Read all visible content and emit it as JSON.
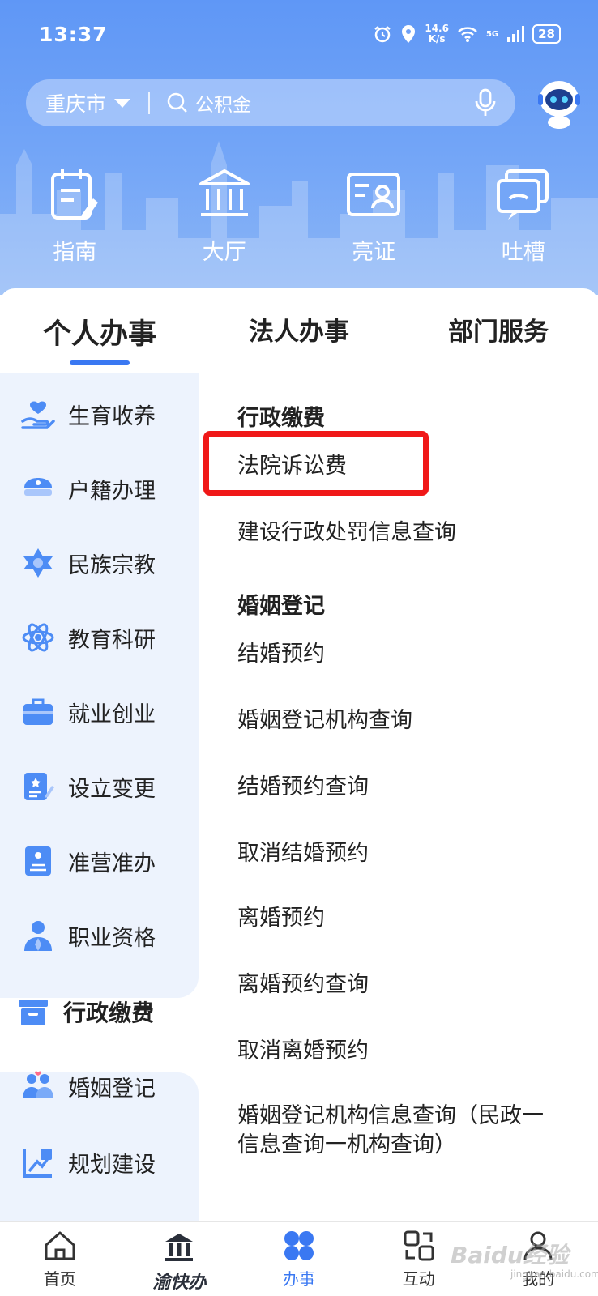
{
  "status_bar": {
    "time": "13:37",
    "net_speed_value": "14.6",
    "net_speed_unit": "K/s",
    "signal": "5G",
    "battery": "28"
  },
  "search": {
    "city": "重庆市",
    "placeholder": "公积金"
  },
  "quick_actions": [
    {
      "label": "指南",
      "icon": "guide-icon"
    },
    {
      "label": "大厅",
      "icon": "hall-icon"
    },
    {
      "label": "亮证",
      "icon": "id-card-icon"
    },
    {
      "label": "吐槽",
      "icon": "feedback-icon"
    }
  ],
  "tabs": [
    {
      "label": "个人办事",
      "active": true
    },
    {
      "label": "法人办事",
      "active": false
    },
    {
      "label": "部门服务",
      "active": false
    }
  ],
  "categories": [
    {
      "label": "生育收养",
      "icon": "hand-heart-icon"
    },
    {
      "label": "户籍办理",
      "icon": "police-cap-icon"
    },
    {
      "label": "民族宗教",
      "icon": "star-icon"
    },
    {
      "label": "教育科研",
      "icon": "atom-icon"
    },
    {
      "label": "就业创业",
      "icon": "briefcase-icon"
    },
    {
      "label": "设立变更",
      "icon": "document-edit-icon"
    },
    {
      "label": "准营准办",
      "icon": "license-icon"
    },
    {
      "label": "职业资格",
      "icon": "professional-icon"
    },
    {
      "label": "行政缴费",
      "icon": "box-icon",
      "active": true
    },
    {
      "label": "婚姻登记",
      "icon": "couple-icon"
    },
    {
      "label": "规划建设",
      "icon": "planning-icon"
    }
  ],
  "sections": [
    {
      "title": "行政缴费",
      "items": [
        "法院诉讼费",
        "建设行政处罚信息查询"
      ]
    },
    {
      "title": "婚姻登记",
      "items": [
        "结婚预约",
        "婚姻登记机构查询",
        "结婚预约查询",
        "取消结婚预约",
        "离婚预约",
        "离婚预约查询",
        "取消离婚预约",
        "婚姻登记机构信息查询（民政一",
        "信息查询一机构查询）"
      ]
    }
  ],
  "bottom_nav": [
    {
      "label": "首页",
      "icon": "home-icon"
    },
    {
      "label": "渝快办",
      "icon": "brand-logo-icon"
    },
    {
      "label": "办事",
      "icon": "grid-icon",
      "active": true
    },
    {
      "label": "互动",
      "icon": "interact-icon"
    },
    {
      "label": "我的",
      "icon": "user-icon"
    }
  ],
  "watermark": {
    "main": "Baidu经验",
    "sub": "jingyan.baidu.com"
  },
  "colors": {
    "accent": "#3a78f2",
    "highlight": "#f01818",
    "header": "#6fa0f6",
    "side_panel": "#edf3fd"
  }
}
